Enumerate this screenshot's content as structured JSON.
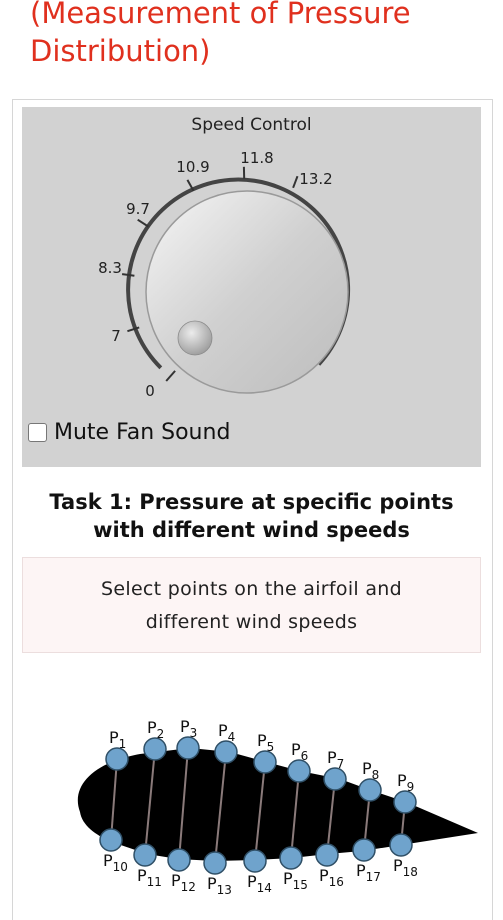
{
  "header": {
    "title": "(Measurement of Pressure Distribution)"
  },
  "speed_control": {
    "title": "Speed Control",
    "ticks": [
      {
        "label": "0"
      },
      {
        "label": "7"
      },
      {
        "label": "8.3"
      },
      {
        "label": "9.7"
      },
      {
        "label": "10.9"
      },
      {
        "label": "11.8"
      },
      {
        "label": "13.2"
      }
    ]
  },
  "mute": {
    "label": "Mute Fan Sound",
    "checked": false
  },
  "task": {
    "title_line1": "Task 1: Pressure at specific points",
    "title_line2": "with different wind speeds",
    "instruction_line1": "Select points on the airfoil and",
    "instruction_line2": "different wind speeds"
  },
  "airfoil": {
    "point_color": "#6fa3cc",
    "top_points": [
      {
        "p": "P",
        "sub": "1"
      },
      {
        "p": "P",
        "sub": "2"
      },
      {
        "p": "P",
        "sub": "3"
      },
      {
        "p": "P",
        "sub": "4"
      },
      {
        "p": "P",
        "sub": "5"
      },
      {
        "p": "P",
        "sub": "6"
      },
      {
        "p": "P",
        "sub": "7"
      },
      {
        "p": "P",
        "sub": "8"
      },
      {
        "p": "P",
        "sub": "9"
      }
    ],
    "bottom_points": [
      {
        "p": "P",
        "sub": "10"
      },
      {
        "p": "P",
        "sub": "11"
      },
      {
        "p": "P",
        "sub": "12"
      },
      {
        "p": "P",
        "sub": "13"
      },
      {
        "p": "P",
        "sub": "14"
      },
      {
        "p": "P",
        "sub": "15"
      },
      {
        "p": "P",
        "sub": "16"
      },
      {
        "p": "P",
        "sub": "17"
      },
      {
        "p": "P",
        "sub": "18"
      }
    ]
  }
}
